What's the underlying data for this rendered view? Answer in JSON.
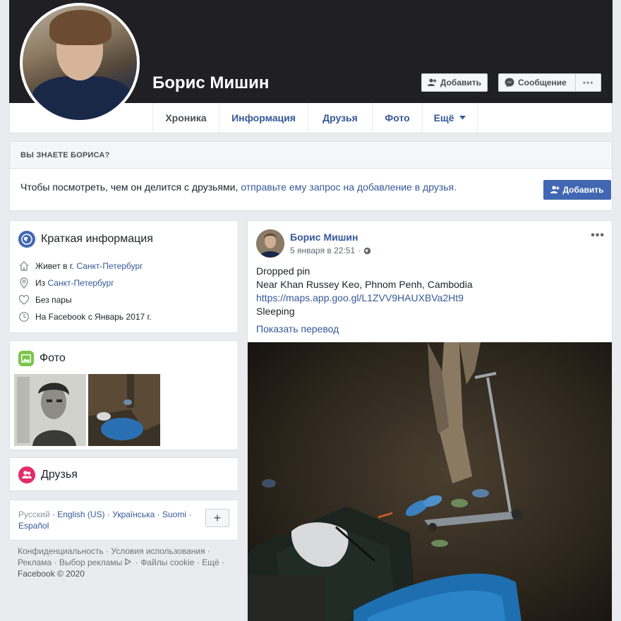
{
  "profile": {
    "name": "Борис Мишин",
    "buttons": {
      "add": "Добавить",
      "message": "Сообщение",
      "more": "•••"
    }
  },
  "tabs": [
    {
      "label": "Хроника",
      "active": true
    },
    {
      "label": "Информация"
    },
    {
      "label": "Друзья"
    },
    {
      "label": "Фото"
    },
    {
      "label": "Ещё"
    }
  ],
  "know": {
    "heading": "ВЫ ЗНАЕТЕ БОРИСА?",
    "text_before": "Чтобы посмотреть, чем он делится с друзьями, ",
    "link": "отправьте ему запрос на добавление в друзья.",
    "button": "Добавить"
  },
  "intro": {
    "title": "Краткая информация",
    "rows": [
      {
        "prefix": "Живет в г. ",
        "link": "Санкт-Петербург",
        "icon": "home-icon"
      },
      {
        "prefix": "Из ",
        "link": "Санкт-Петербург",
        "icon": "location-pin-icon"
      },
      {
        "prefix": "Без пары",
        "link": "",
        "icon": "heart-icon"
      },
      {
        "prefix": "На Facebook с Январь 2017 г.",
        "link": "",
        "icon": "clock-icon"
      }
    ]
  },
  "photos": {
    "title": "Фото"
  },
  "friends": {
    "title": "Друзья"
  },
  "languages": {
    "current": "Русский",
    "others": [
      "English (US)",
      "Українська",
      "Suomi",
      "Español"
    ],
    "plus": "+"
  },
  "footer": {
    "links": [
      "Конфиденциальность",
      "Условия использования",
      "Реклама",
      "Выбор рекламы",
      "Файлы cookie",
      "Ещё"
    ],
    "copyright": "Facebook © 2020"
  },
  "post": {
    "author": "Борис Мишин",
    "date": "5 января в 22:51",
    "dots": "•••",
    "lines": [
      "Dropped pin",
      "Near Khan Russey Keo, Phnom Penh, Cambodia"
    ],
    "link": "https://maps.app.goo.gl/L1ZVV9HAUXBVa2Ht9",
    "last_line": "Sleeping",
    "translate": "Показать перевод"
  },
  "colors": {
    "link": "#365899",
    "primary_button": "#4267b2",
    "cover": "#1f1f24"
  }
}
